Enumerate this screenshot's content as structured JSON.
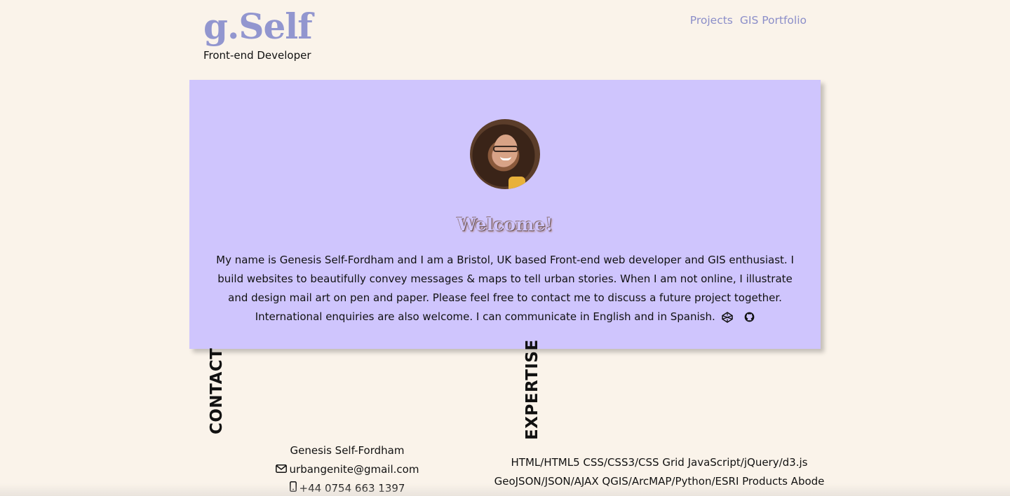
{
  "header": {
    "logo": "g.Self",
    "tagline": "Front-end Developer",
    "nav": [
      "Projects",
      "GIS Portfolio"
    ]
  },
  "hero": {
    "title": "Welcome!",
    "bio": "My name is Genesis Self-Fordham and I am a Bristol, UK based Front-end web developer and GIS enthusiast. I build websites to beautifully convey messages & maps to tell urban stories. When I am not online, I illustrate and design mail art on pen and paper. Please feel free to contact me to discuss a future project together. International enquiries are also welcome. I can communicate in English and in Spanish.",
    "icons": [
      "codepen-icon",
      "github-icon"
    ]
  },
  "contact": {
    "heading": "CONTACT",
    "name": "Genesis Self-Fordham",
    "email": "urbangenite@gmail.com",
    "phone": "+44 0754 663 1397"
  },
  "expertise": {
    "heading": "EXPERTISE",
    "line1": "HTML/HTML5 CSS/CSS3/CSS Grid JavaScript/jQuery/d3.js",
    "line2": "GeoJSON/JSON/AJAX QGIS/ArcMAP/Python/ESRI Products Abode"
  },
  "colors": {
    "background": "#faf3ea",
    "card": "#cfc5fd",
    "accent": "#9296cf"
  }
}
